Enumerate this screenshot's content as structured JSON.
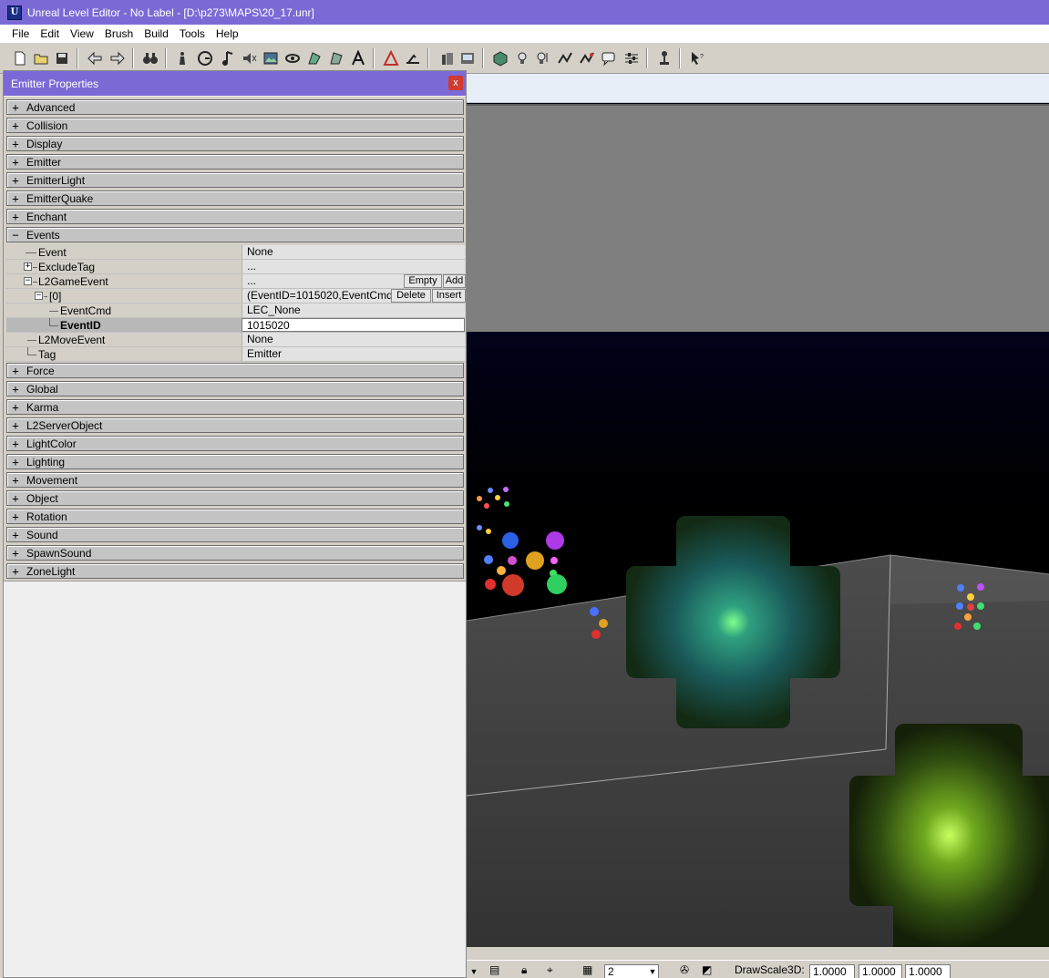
{
  "window": {
    "title": "Unreal Level Editor - No Label - [D:\\p273\\MAPS\\20_17.unr]",
    "app_icon_letter": "U"
  },
  "menu": [
    "File",
    "Edit",
    "View",
    "Brush",
    "Build",
    "Tools",
    "Help"
  ],
  "toolbar": {
    "icons": [
      "new-file-icon",
      "open-folder-icon",
      "save-icon",
      "undo-icon",
      "redo-icon",
      "search-binoculars-icon",
      "actor-icon",
      "group-icon",
      "music-icon",
      "sound-icon",
      "texture-icon",
      "mesh-icon",
      "animation-icon",
      "static-mesh-icon",
      "font-icon",
      "prefab-icon",
      "terrain-icon",
      "camera-icon",
      "light-icon",
      "player-start-icon",
      "path-icon",
      "merge-icon",
      "cube-icon",
      "bulb-icon",
      "lights-icon",
      "wave-icon",
      "wave2-icon",
      "chat-icon",
      "sliders-icon",
      "pawn-icon",
      "select-help-icon"
    ]
  },
  "panel": {
    "title": "Emitter Properties",
    "close_label": "x",
    "categories_top": [
      "Advanced",
      "Collision",
      "Display",
      "Emitter",
      "EmitterLight",
      "EmitterQuake",
      "Enchant"
    ],
    "expanded_category": "Events",
    "expand_symbol": "+",
    "collapse_symbol": "−",
    "events": {
      "event": {
        "name": "Event",
        "value": "None"
      },
      "exclude_tag": {
        "name": "ExcludeTag",
        "value": "..."
      },
      "l2_game_event": {
        "name": "L2GameEvent",
        "value": "...",
        "empty_label": "Empty",
        "add_label": "Add"
      },
      "index0": {
        "name": "[0]",
        "value": "(EventID=1015020,EventCmd=...",
        "delete_label": "Delete",
        "insert_label": "Insert"
      },
      "event_cmd": {
        "name": "EventCmd",
        "value": "LEC_None"
      },
      "event_id": {
        "name": "EventID",
        "value": "1015020"
      },
      "l2_move_event": {
        "name": "L2MoveEvent",
        "value": "None"
      },
      "tag": {
        "name": "Tag",
        "value": "Emitter"
      }
    },
    "categories_bottom": [
      "Force",
      "Global",
      "Karma",
      "L2ServerObject",
      "LightColor",
      "Lighting",
      "Movement",
      "Object",
      "Rotation",
      "Sound",
      "SpawnSound",
      "ZoneLight"
    ]
  },
  "statusbar": {
    "grid_value": "2",
    "drawscale_label": "DrawScale3D:",
    "drawscale_x": "1.0000",
    "drawscale_y": "1.0000",
    "drawscale_z": "1.0000"
  },
  "colors": {
    "titlebar": "#7b6ad6",
    "close_button": "#d03a30",
    "emitter_cyan": "#1f7a80",
    "emitter_green": "#6fa81e"
  }
}
